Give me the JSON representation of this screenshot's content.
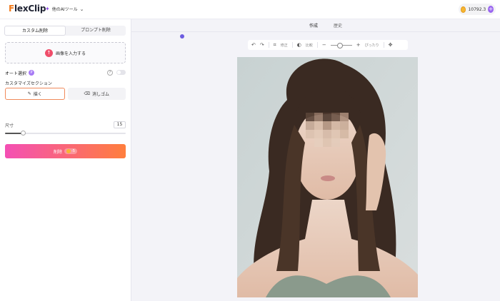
{
  "header": {
    "logo_first": "F",
    "logo_rest": "lexClip",
    "tools_label": "他のAIツール",
    "credits": "10792.3"
  },
  "left_panel": {
    "modes": [
      "カスタム削除",
      "プロンプト削除"
    ],
    "upload_label": "画像を入力する",
    "auto_select_label": "オート選択",
    "auto_select_badge": "P",
    "section_title": "カスタマイズセクション",
    "brush_label": "描く",
    "eraser_label": "消しゴム",
    "size_label": "尺寸",
    "size_value": "15",
    "size_fraction": 0.15,
    "erase_button_label": "削除",
    "erase_cost": "-5"
  },
  "workspace": {
    "tabs": [
      "作成",
      "歴史"
    ],
    "toolbar": {
      "crop_label": "修正",
      "compare_label": "比較",
      "fit_label": "ぴったり"
    }
  },
  "icons": {
    "undo": "undo-icon",
    "redo": "redo-icon",
    "crop": "crop-icon",
    "compare": "compare-icon",
    "move": "move-icon"
  },
  "colors": {
    "accent": "#7c4df0",
    "gradient_start": "#f44fb4",
    "gradient_end": "#ff7e3d",
    "logo_orange": "#f27a1a"
  }
}
